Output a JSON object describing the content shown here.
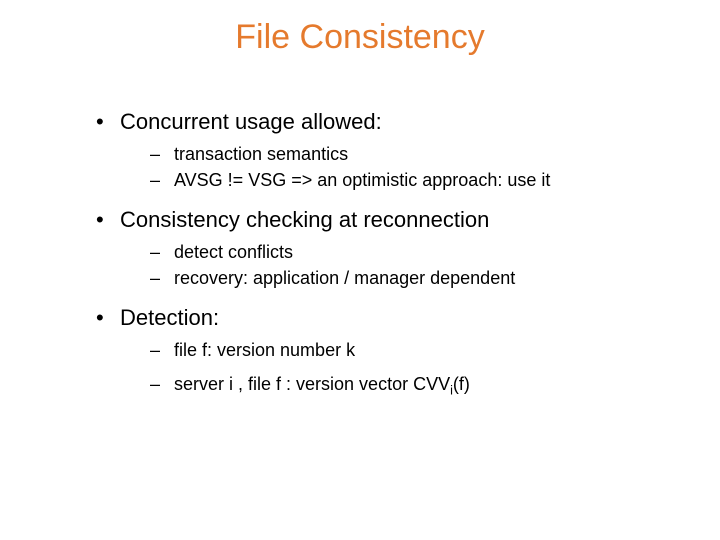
{
  "title": "File Consistency",
  "bullets": [
    {
      "text": "Concurrent usage allowed:",
      "sub": [
        "transaction semantics",
        "AVSG != VSG => an optimistic approach: use it"
      ]
    },
    {
      "text": "Consistency checking at reconnection",
      "sub": [
        "detect conflicts",
        "recovery:  application / manager dependent"
      ]
    },
    {
      "text": "Detection:",
      "sub": [
        "file f: version number k",
        {
          "prefix": "server i , file f : version vector CVV",
          "sub": "i",
          "suffix": "(f)"
        }
      ]
    }
  ]
}
